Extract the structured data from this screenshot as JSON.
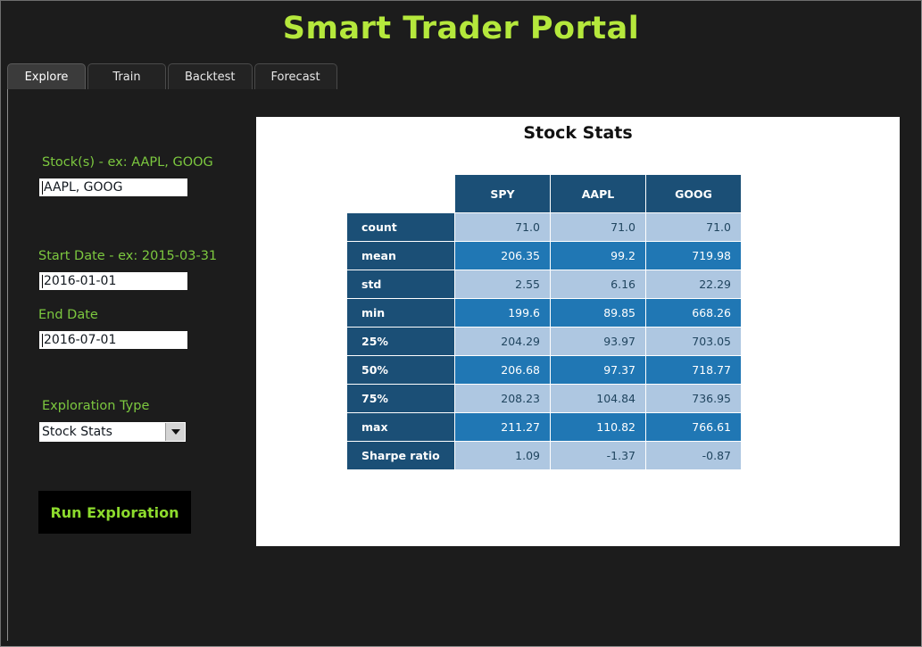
{
  "app": {
    "title": "Smart Trader Portal",
    "accent_green": "#b5e83c",
    "label_green": "#7cc83f",
    "background": "#1c1c1c"
  },
  "tabs": [
    {
      "label": "Explore",
      "active": true
    },
    {
      "label": "Train",
      "active": false
    },
    {
      "label": "Backtest",
      "active": false
    },
    {
      "label": "Forecast",
      "active": false
    }
  ],
  "sidebar": {
    "stocks": {
      "label": "Stock(s) - ex: AAPL, GOOG",
      "value": "AAPL, GOOG",
      "placeholder": "AAPL, GOOG"
    },
    "start_date": {
      "label": "Start Date - ex: 2015-03-31",
      "value": "2016-01-01",
      "placeholder": "2015-03-31"
    },
    "end_date": {
      "label": "End Date",
      "value": "2016-07-01",
      "placeholder": "2016-07-01"
    },
    "exploration_type": {
      "label": "Exploration Type",
      "value": "Stock Stats",
      "options": [
        "Stock Stats"
      ]
    },
    "run_button": {
      "label": "Run Exploration"
    }
  },
  "result": {
    "title": "Stock Stats"
  },
  "chart_data": {
    "type": "table",
    "title": "Stock Stats",
    "index_header": "",
    "categories": [
      "SPY",
      "AAPL",
      "GOOG"
    ],
    "rows": [
      {
        "label": "count",
        "values": [
          "71.0",
          "71.0",
          "71.0"
        ]
      },
      {
        "label": "mean",
        "values": [
          "206.35",
          "99.2",
          "719.98"
        ]
      },
      {
        "label": "std",
        "values": [
          "2.55",
          "6.16",
          "22.29"
        ]
      },
      {
        "label": "min",
        "values": [
          "199.6",
          "89.85",
          "668.26"
        ]
      },
      {
        "label": "25%",
        "values": [
          "204.29",
          "93.97",
          "703.05"
        ]
      },
      {
        "label": "50%",
        "values": [
          "206.68",
          "97.37",
          "718.77"
        ]
      },
      {
        "label": "75%",
        "values": [
          "208.23",
          "104.84",
          "736.95"
        ]
      },
      {
        "label": "max",
        "values": [
          "211.27",
          "110.82",
          "766.61"
        ]
      },
      {
        "label": "Sharpe ratio",
        "values": [
          "1.09",
          "-1.37",
          "-0.87"
        ]
      }
    ],
    "colors": {
      "header": "#1b4f76",
      "row_light": "#aec7e1",
      "row_dark": "#2077b4"
    }
  }
}
